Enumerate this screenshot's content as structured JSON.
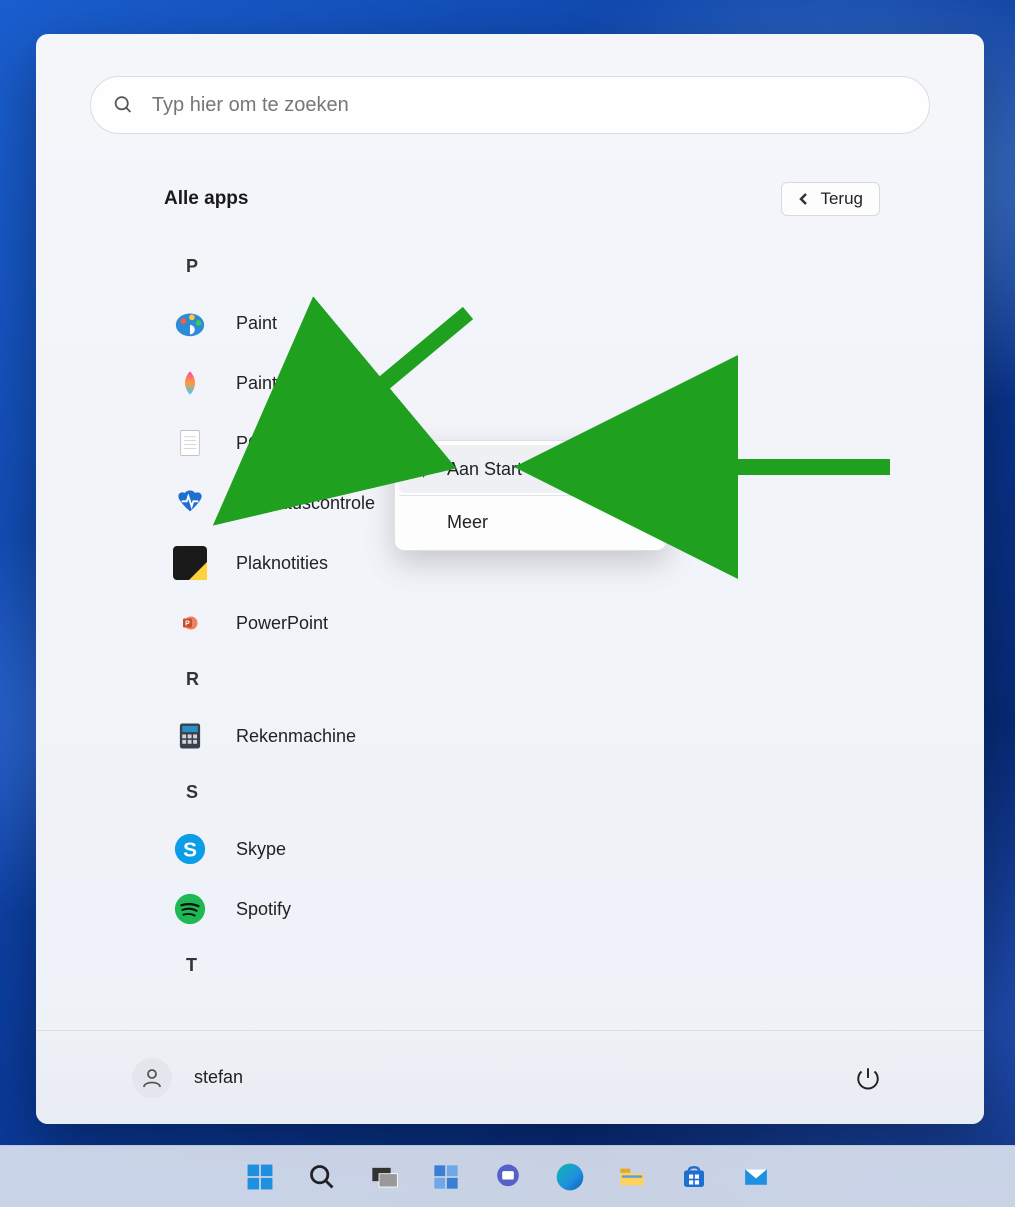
{
  "search": {
    "placeholder": "Typ hier om te zoeken"
  },
  "header": {
    "title": "Alle apps",
    "back_label": "Terug"
  },
  "letters": {
    "P": "P",
    "R": "R",
    "S": "S",
    "T": "T"
  },
  "apps": {
    "paint": "Paint",
    "paint3d": "Paint 3D",
    "pctips": "PC tips - Snelkoppeling",
    "pcstatus": "Pc-statuscontrole",
    "plaknotities": "Plaknotities",
    "powerpoint": "PowerPoint",
    "rekenmachine": "Rekenmachine",
    "skype": "Skype",
    "spotify": "Spotify"
  },
  "context_menu": {
    "pin": "Aan Start vastmaken",
    "more": "Meer"
  },
  "footer": {
    "username": "stefan"
  },
  "taskbar": {
    "start": "start-icon",
    "search": "search-icon",
    "taskview": "taskview-icon",
    "widgets": "widgets-icon",
    "chat": "chat-icon",
    "edge": "edge-icon",
    "explorer": "explorer-icon",
    "store": "store-icon",
    "mail": "mail-icon"
  }
}
